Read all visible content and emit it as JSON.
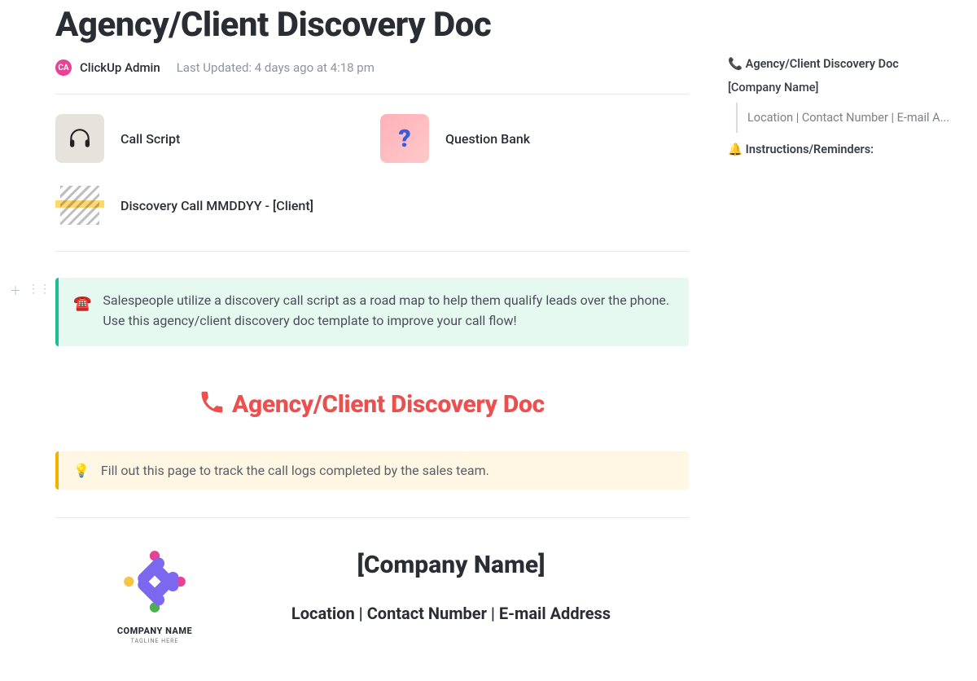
{
  "header": {
    "title": "Agency/Client Discovery Doc",
    "avatar_initials": "CA",
    "author": "ClickUp Admin",
    "last_updated_label": "Last Updated:",
    "last_updated_value": "4 days ago at 4:18 pm"
  },
  "subpages": [
    {
      "label": "Call Script",
      "icon": "headphones-icon"
    },
    {
      "label": "Question Bank",
      "icon": "question-icon"
    },
    {
      "label": "Discovery Call MMDDYY - [Client]",
      "icon": "papers-icon"
    }
  ],
  "intro_callout": {
    "emoji": "☎️",
    "text": "Salespeople utilize a discovery call script as a road map to help them qualify leads over the phone. Use this agency/client discovery doc template to improve your call flow!"
  },
  "doc_heading": {
    "emoji": "📞",
    "text": "Agency/Client Discovery Doc"
  },
  "tip_callout": {
    "emoji": "💡",
    "text": "Fill out this page to track the call logs completed by the sales team."
  },
  "company": {
    "logo_name": "COMPANY NAME",
    "logo_tagline": "TAGLINE HERE",
    "title": "[Company Name]",
    "subtitle": "Location | Contact Number | E-mail Address"
  },
  "outline": {
    "items": [
      {
        "emoji": "📞",
        "label": "Agency/Client Discovery Doc",
        "level": 1
      },
      {
        "emoji": "",
        "label": "[Company Name]",
        "level": 2
      },
      {
        "emoji": "",
        "label": "Location | Contact Number | E-mail A...",
        "level": 3
      },
      {
        "emoji": "🔔",
        "label": "Instructions/Reminders:",
        "level": 1
      }
    ]
  }
}
